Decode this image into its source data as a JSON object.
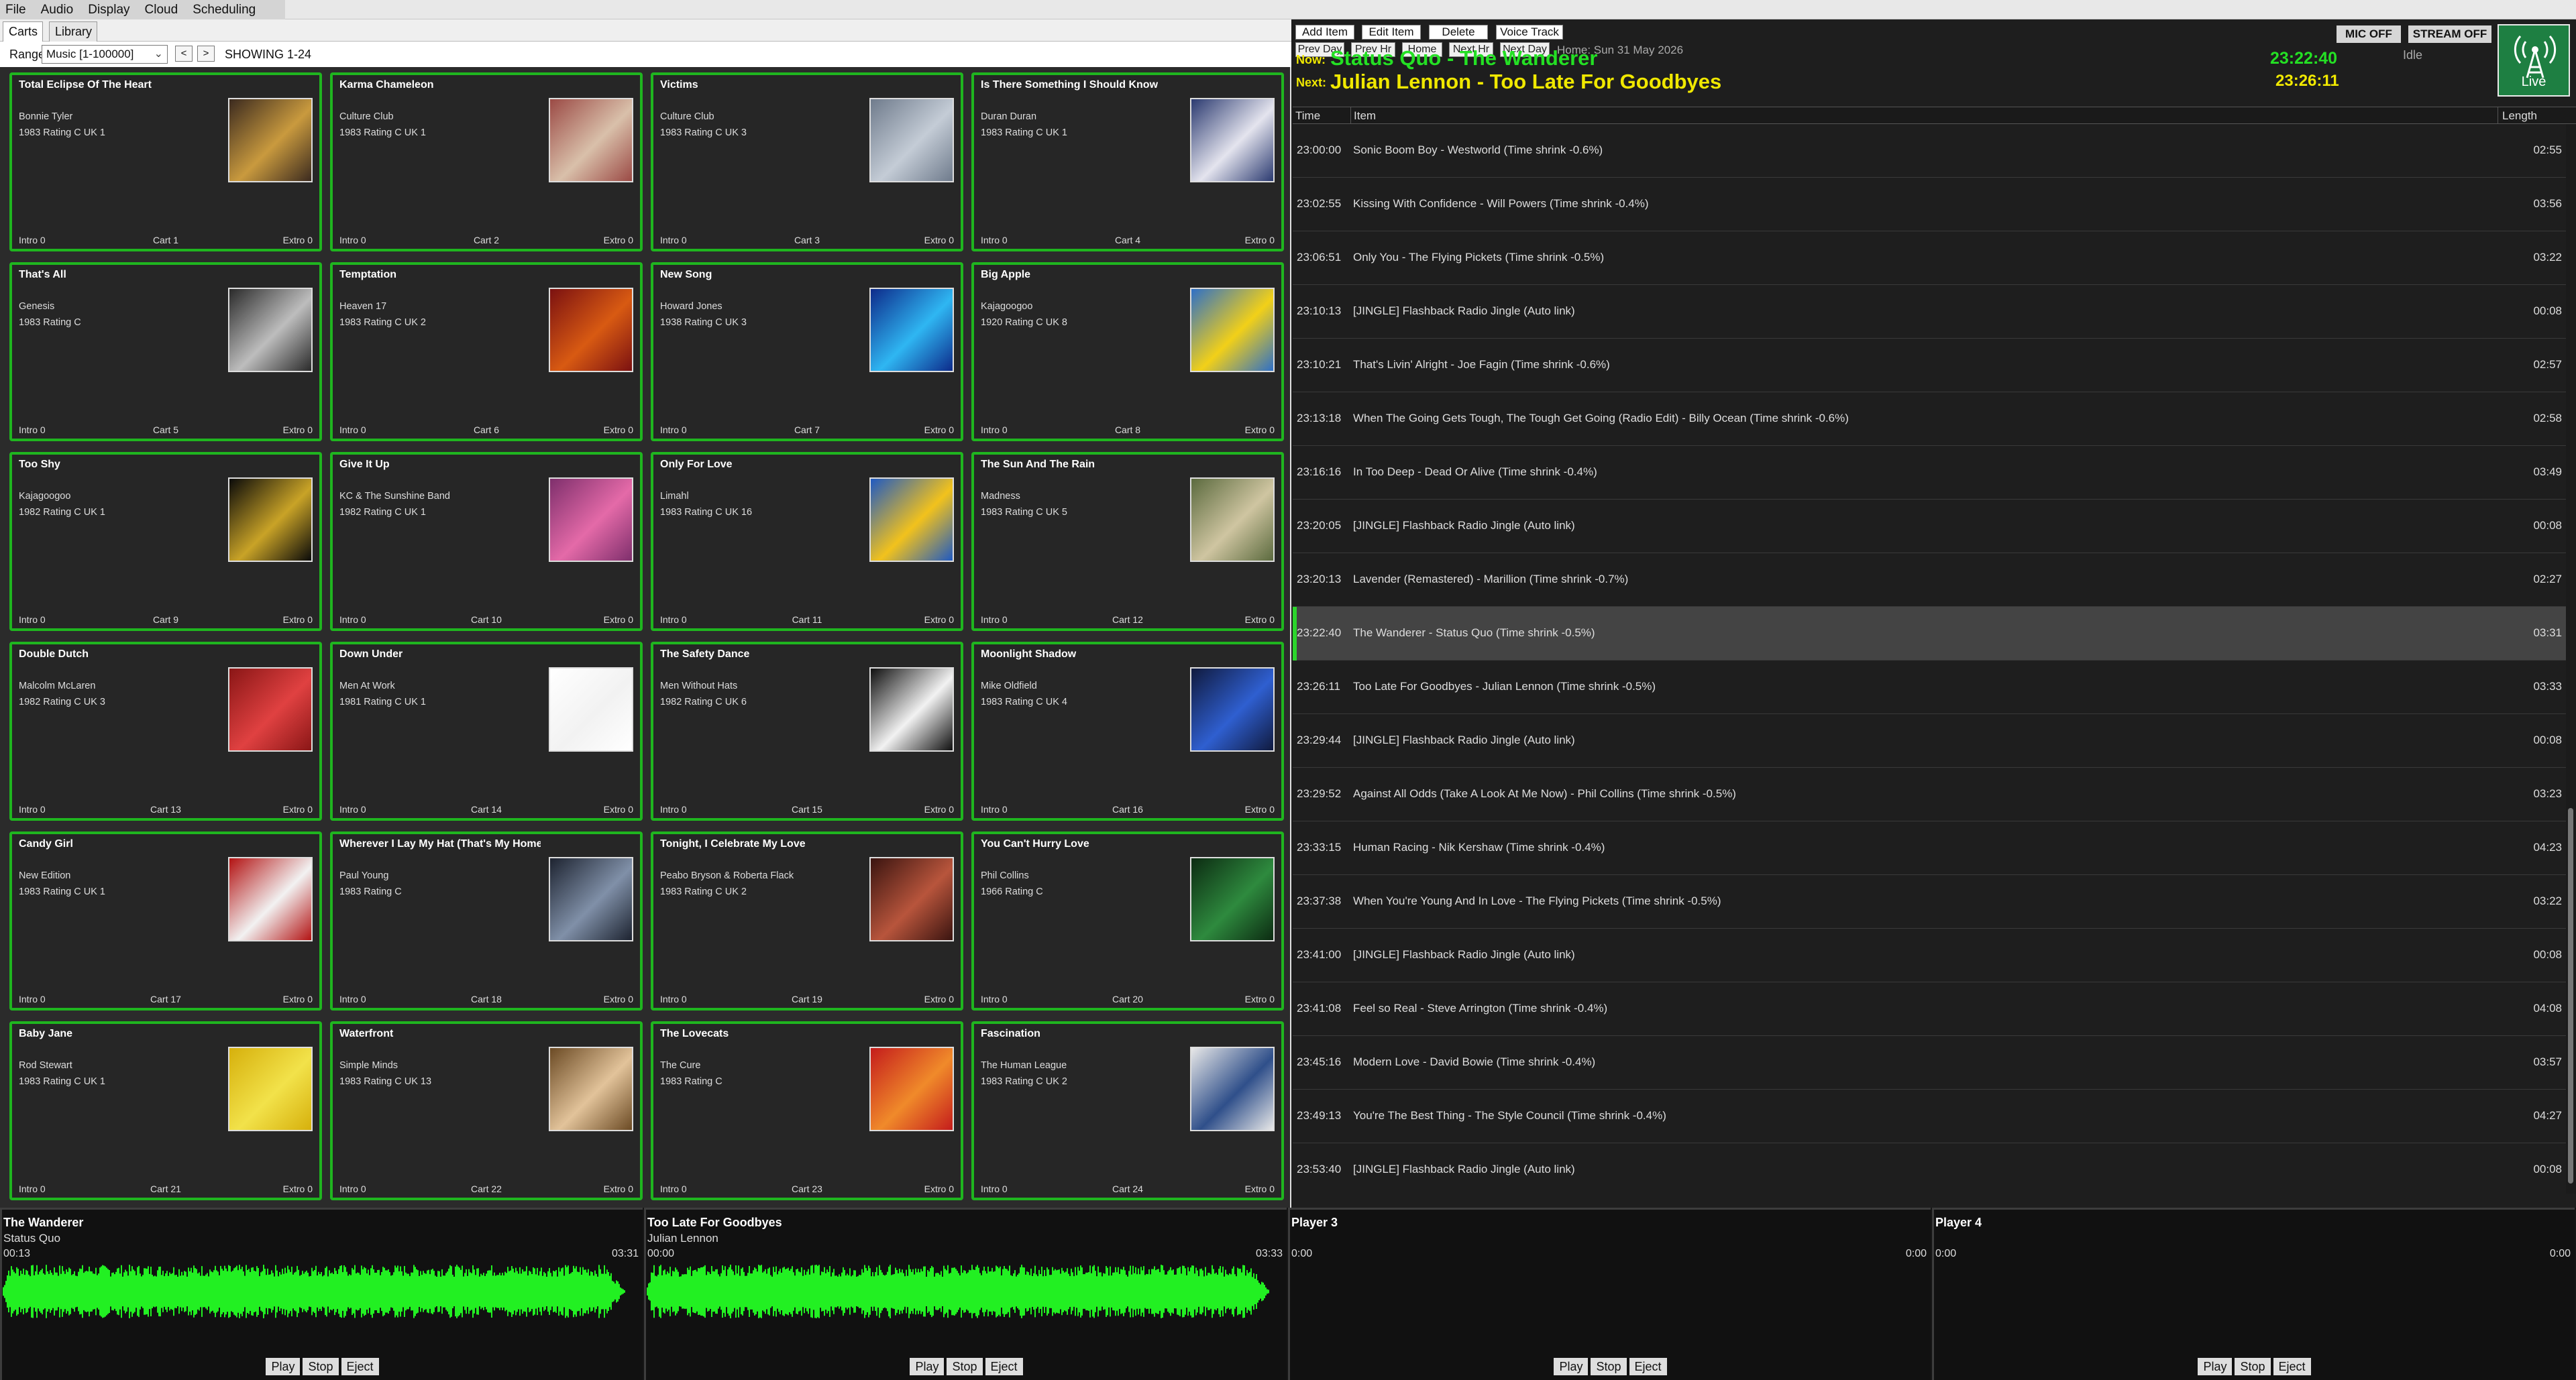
{
  "menu": {
    "items": [
      "File",
      "Audio",
      "Display",
      "Cloud",
      "Scheduling"
    ]
  },
  "carts_panel": {
    "tabs": [
      "Carts",
      "Library"
    ],
    "range_label": "Range",
    "range_value": "Music [1-100000]",
    "prev": "<",
    "next": ">",
    "showing": "SHOWING 1-24"
  },
  "carts": [
    {
      "title": "Total Eclipse Of The Heart",
      "artist": "Bonnie Tyler",
      "meta": "1983  Rating C  UK 1",
      "intro": "Intro 0",
      "cart": "Cart 1",
      "extro": "Extro 0",
      "art": [
        "#3b2a1f",
        "#c99a3e"
      ]
    },
    {
      "title": "Karma Chameleon",
      "artist": "Culture Club",
      "meta": "1983  Rating C  UK 1",
      "intro": "Intro 0",
      "cart": "Cart 2",
      "extro": "Extro 0",
      "art": [
        "#9b4a45",
        "#d9c0aa"
      ]
    },
    {
      "title": "Victims",
      "artist": "Culture Club",
      "meta": "1983  Rating C  UK 3",
      "intro": "Intro 0",
      "cart": "Cart 3",
      "extro": "Extro 0",
      "art": [
        "#6f7b8c",
        "#c4ccd6"
      ]
    },
    {
      "title": "Is There Something I Should Know",
      "artist": "Duran Duran",
      "meta": "1983  Rating C  UK 1",
      "intro": "Intro 0",
      "cart": "Cart 4",
      "extro": "Extro 0",
      "art": [
        "#2b3a70",
        "#e4e4ee"
      ]
    },
    {
      "title": "That's All",
      "artist": "Genesis",
      "meta": "1983  Rating C",
      "intro": "Intro 0",
      "cart": "Cart 5",
      "extro": "Extro 0",
      "art": [
        "#2a2a2a",
        "#bdbdbd"
      ]
    },
    {
      "title": "Temptation",
      "artist": "Heaven 17",
      "meta": "1983  Rating C  UK 2",
      "intro": "Intro 0",
      "cart": "Cart 6",
      "extro": "Extro 0",
      "art": [
        "#7b1111",
        "#d85a12"
      ]
    },
    {
      "title": "New Song",
      "artist": "Howard Jones",
      "meta": "1938  Rating C  UK 3",
      "intro": "Intro 0",
      "cart": "Cart 7",
      "extro": "Extro 0",
      "art": [
        "#0d2a8a",
        "#2fb6f2"
      ]
    },
    {
      "title": "Big Apple",
      "artist": "Kajagoogoo",
      "meta": "1920  Rating C  UK 8",
      "intro": "Intro 0",
      "cart": "Cart 8",
      "extro": "Extro 0",
      "art": [
        "#2e6fc7",
        "#f2d018"
      ]
    },
    {
      "title": "Too Shy",
      "artist": "Kajagoogoo",
      "meta": "1982  Rating C  UK 1",
      "intro": "Intro 0",
      "cart": "Cart 9",
      "extro": "Extro 0",
      "art": [
        "#0a0a0a",
        "#c9a327"
      ]
    },
    {
      "title": "Give It Up",
      "artist": "KC & The Sunshine Band",
      "meta": "1982  Rating C  UK 1",
      "intro": "Intro 0",
      "cart": "Cart 10",
      "extro": "Extro 0",
      "art": [
        "#7e2f6c",
        "#e46aa8"
      ]
    },
    {
      "title": "Only For Love",
      "artist": "Limahl",
      "meta": "1983  Rating C  UK 16",
      "intro": "Intro 0",
      "cart": "Cart 11",
      "extro": "Extro 0",
      "art": [
        "#1f59c2",
        "#f2c21c"
      ]
    },
    {
      "title": "The Sun And The Rain",
      "artist": "Madness",
      "meta": "1983  Rating C  UK 5",
      "intro": "Intro 0",
      "cart": "Cart 12",
      "extro": "Extro 0",
      "art": [
        "#5b6a3e",
        "#cfc5a1"
      ]
    },
    {
      "title": "Double Dutch",
      "artist": "Malcolm McLaren",
      "meta": "1982  Rating C  UK 3",
      "intro": "Intro 0",
      "cart": "Cart 13",
      "extro": "Extro 0",
      "art": [
        "#8a1616",
        "#e04141"
      ]
    },
    {
      "title": "Down Under",
      "artist": "Men At Work",
      "meta": "1981  Rating C  UK 1",
      "intro": "Intro 0",
      "cart": "Cart 14",
      "extro": "Extro 0",
      "art": [
        "#ffffff",
        "#f2f2f2"
      ]
    },
    {
      "title": "The Safety Dance",
      "artist": "Men Without Hats",
      "meta": "1982  Rating C  UK 6",
      "intro": "Intro 0",
      "cart": "Cart 15",
      "extro": "Extro 0",
      "art": [
        "#0f0f0f",
        "#f2f2f2"
      ]
    },
    {
      "title": "Moonlight Shadow",
      "artist": "Mike Oldfield",
      "meta": "1983  Rating C  UK 4",
      "intro": "Intro 0",
      "cart": "Cart 16",
      "extro": "Extro 0",
      "art": [
        "#101a3e",
        "#2f5fd0"
      ]
    },
    {
      "title": "Candy Girl",
      "artist": "New Edition",
      "meta": "1983  Rating C  UK 1",
      "intro": "Intro 0",
      "cart": "Cart 17",
      "extro": "Extro 0",
      "art": [
        "#b31313",
        "#f2f2f2"
      ]
    },
    {
      "title": "Wherever I Lay My Hat (That's My Home",
      "artist": "Paul Young",
      "meta": "1983  Rating C",
      "intro": "Intro 0",
      "cart": "Cart 18",
      "extro": "Extro 0",
      "art": [
        "#1d2330",
        "#8090a8"
      ]
    },
    {
      "title": "Tonight, I Celebrate My Love",
      "artist": "Peabo Bryson & Roberta Flack",
      "meta": "1983  Rating C  UK 2",
      "intro": "Intro 0",
      "cart": "Cart 19",
      "extro": "Extro 0",
      "art": [
        "#3a1410",
        "#b8553c"
      ]
    },
    {
      "title": "You Can't Hurry Love",
      "artist": "Phil Collins",
      "meta": "1966  Rating C",
      "intro": "Intro 0",
      "cart": "Cart 20",
      "extro": "Extro 0",
      "art": [
        "#0c2b12",
        "#2e8a3e"
      ]
    },
    {
      "title": "Baby Jane",
      "artist": "Rod Stewart",
      "meta": "1983  Rating C  UK 1",
      "intro": "Intro 0",
      "cart": "Cart 21",
      "extro": "Extro 0",
      "art": [
        "#d6b00c",
        "#f2e24a"
      ]
    },
    {
      "title": "Waterfront",
      "artist": "Simple Minds",
      "meta": "1983  Rating C  UK 13",
      "intro": "Intro 0",
      "cart": "Cart 22",
      "extro": "Extro 0",
      "art": [
        "#6b4a24",
        "#e2c39a"
      ]
    },
    {
      "title": "The Lovecats",
      "artist": "The Cure",
      "meta": "1983  Rating C",
      "intro": "Intro 0",
      "cart": "Cart 23",
      "extro": "Extro 0",
      "art": [
        "#c41c1c",
        "#f08a2a"
      ]
    },
    {
      "title": "Fascination",
      "artist": "The Human League",
      "meta": "1983  Rating C  UK 2",
      "intro": "Intro 0",
      "cart": "Cart 24",
      "extro": "Extro 0",
      "art": [
        "#e8e8e8",
        "#2f4f8a"
      ]
    }
  ],
  "playlist_panel": {
    "buttons": {
      "add": "Add Item",
      "edit": "Edit Item",
      "delete": "Delete",
      "voice": "Voice Track",
      "prev_day": "Prev Day",
      "prev_hr": "Prev Hr",
      "home": "Home",
      "next_hr": "Next Hr",
      "next_day": "Next Day"
    },
    "home_date": "Home: Sun 31 May 2026",
    "now_label": "Now:",
    "now_text": "Status Quo - The Wanderer",
    "next_label": "Next:",
    "next_text": "Julian Lennon - Too Late For Goodbyes",
    "clock_now": "23:22:40",
    "clock_next": "23:26:11",
    "status": "Idle",
    "mic": "MIC OFF",
    "stream": "STREAM OFF",
    "live": "Live",
    "columns": {
      "time": "Time",
      "item": "Item",
      "length": "Length"
    },
    "accent": "#24e024",
    "next_color": "#f0e800",
    "rows": [
      {
        "time": "23:00:00",
        "item": "Sonic Boom Boy - Westworld  (Time shrink -0.6%)",
        "length": "02:55"
      },
      {
        "time": "23:02:55",
        "item": "Kissing With Confidence - Will Powers  (Time shrink -0.4%)",
        "length": "03:56"
      },
      {
        "time": "23:06:51",
        "item": "Only You - The Flying Pickets  (Time shrink -0.5%)",
        "length": "03:22"
      },
      {
        "time": "23:10:13",
        "item": "[JINGLE] Flashback Radio Jingle  (Auto link)",
        "length": "00:08"
      },
      {
        "time": "23:10:21",
        "item": "That's Livin' Alright - Joe Fagin  (Time shrink -0.6%)",
        "length": "02:57"
      },
      {
        "time": "23:13:18",
        "item": "When The Going Gets Tough, The Tough Get Going (Radio Edit) - Billy Ocean  (Time shrink -0.6%)",
        "length": "02:58"
      },
      {
        "time": "23:16:16",
        "item": "In Too Deep - Dead Or Alive  (Time shrink -0.4%)",
        "length": "03:49"
      },
      {
        "time": "23:20:05",
        "item": "[JINGLE] Flashback Radio Jingle  (Auto link)",
        "length": "00:08"
      },
      {
        "time": "23:20:13",
        "item": "Lavender (Remastered) - Marillion  (Time shrink -0.7%)",
        "length": "02:27"
      },
      {
        "time": "23:22:40",
        "item": "The Wanderer - Status Quo  (Time shrink -0.5%)",
        "length": "03:31",
        "active": true
      },
      {
        "time": "23:26:11",
        "item": "Too Late For Goodbyes - Julian Lennon  (Time shrink -0.5%)",
        "length": "03:33"
      },
      {
        "time": "23:29:44",
        "item": "[JINGLE] Flashback Radio Jingle  (Auto link)",
        "length": "00:08"
      },
      {
        "time": "23:29:52",
        "item": "Against All Odds (Take A Look At Me Now) - Phil Collins  (Time shrink -0.5%)",
        "length": "03:23"
      },
      {
        "time": "23:33:15",
        "item": "Human Racing - Nik Kershaw  (Time shrink -0.4%)",
        "length": "04:23"
      },
      {
        "time": "23:37:38",
        "item": "When You're Young And In Love - The Flying Pickets  (Time shrink -0.5%)",
        "length": "03:22"
      },
      {
        "time": "23:41:00",
        "item": "[JINGLE] Flashback Radio Jingle  (Auto link)",
        "length": "00:08"
      },
      {
        "time": "23:41:08",
        "item": "Feel so Real - Steve Arrington  (Time shrink -0.4%)",
        "length": "04:08"
      },
      {
        "time": "23:45:16",
        "item": "Modern Love - David Bowie  (Time shrink -0.4%)",
        "length": "03:57"
      },
      {
        "time": "23:49:13",
        "item": "You're The Best Thing - The Style Council  (Time shrink -0.4%)",
        "length": "04:27"
      },
      {
        "time": "23:53:40",
        "item": "[JINGLE] Flashback Radio Jingle  (Auto link)",
        "length": "00:08"
      }
    ]
  },
  "players": [
    {
      "title": "The Wanderer",
      "artist": "Status Quo",
      "position": "00:13",
      "duration": "03:31",
      "has_wave": true,
      "controls": [
        "Play",
        "Stop",
        "Eject"
      ]
    },
    {
      "title": "Too Late For Goodbyes",
      "artist": "Julian Lennon",
      "position": "00:00",
      "duration": "03:33",
      "has_wave": true,
      "controls": [
        "Play",
        "Stop",
        "Eject"
      ]
    },
    {
      "title": "Player 3",
      "artist": "",
      "position": "0:00",
      "duration": "0:00",
      "has_wave": false,
      "controls": [
        "Play",
        "Stop",
        "Eject"
      ]
    },
    {
      "title": "Player 4",
      "artist": "",
      "position": "0:00",
      "duration": "0:00",
      "has_wave": false,
      "controls": [
        "Play",
        "Stop",
        "Eject"
      ]
    }
  ],
  "waveform_color": "#22f022"
}
